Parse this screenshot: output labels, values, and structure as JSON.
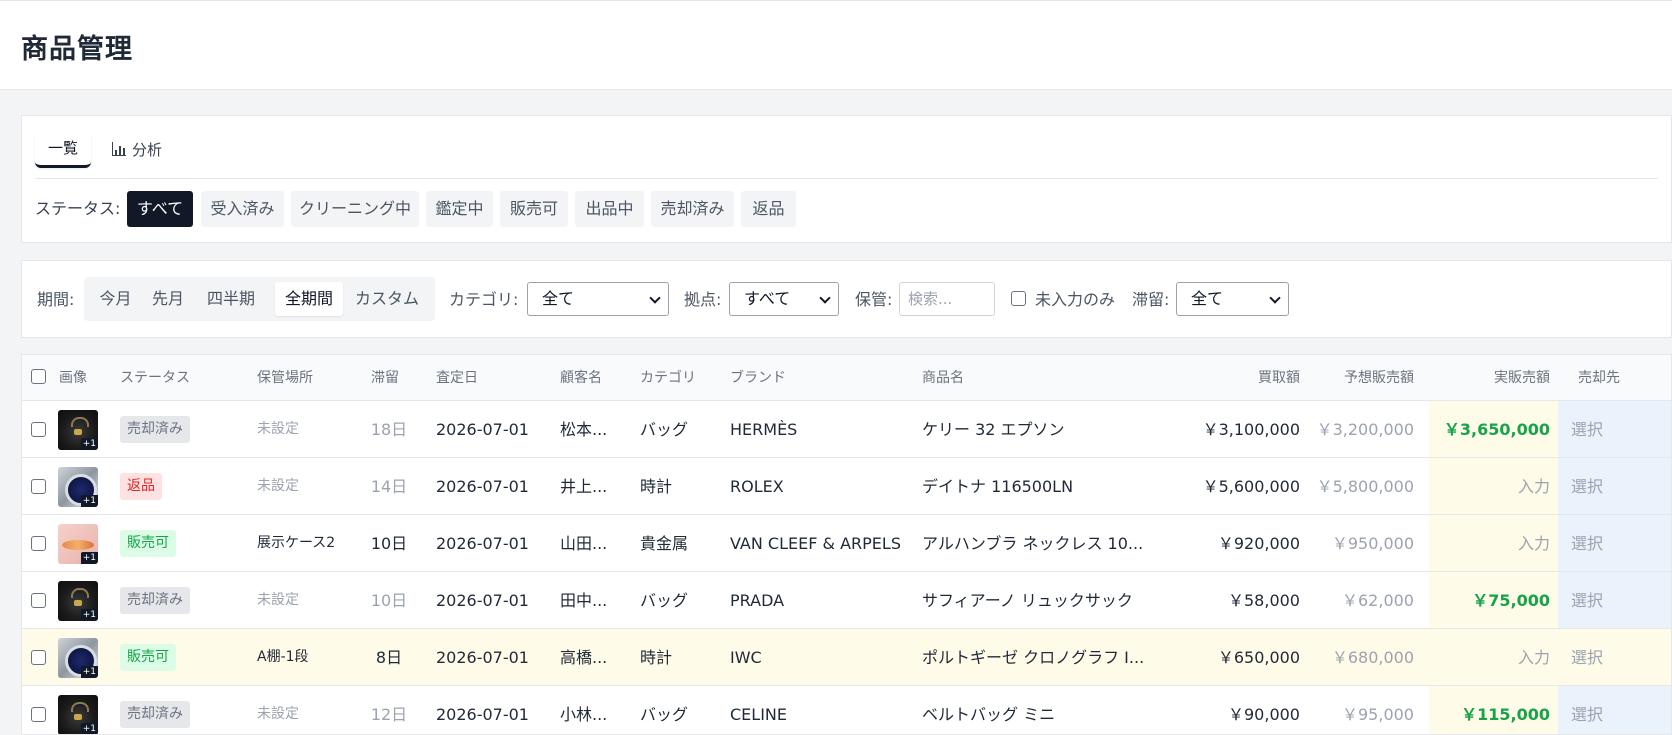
{
  "page": {
    "title": "商品管理"
  },
  "tabs": {
    "list": "一覧",
    "analysis": "分析"
  },
  "status_filter": {
    "label": "ステータス:",
    "options": [
      "すべて",
      "受入済み",
      "クリーニング中",
      "鑑定中",
      "販売可",
      "出品中",
      "売却済み",
      "返品"
    ],
    "selected": "すべて"
  },
  "filters": {
    "period_label": "期間:",
    "periods": [
      "今月",
      "先月",
      "四半期",
      "全期間",
      "カスタム"
    ],
    "period_selected": "全期間",
    "category_label": "カテゴリ:",
    "category_value": "全て",
    "location_label": "拠点:",
    "location_value": "すべて",
    "storage_label": "保管:",
    "storage_placeholder": "検索...",
    "unentered_label": "未入力のみ",
    "stagnation_label": "滞留:",
    "stagnation_value": "全て"
  },
  "table": {
    "headers": {
      "image": "画像",
      "status": "ステータス",
      "location": "保管場所",
      "stagnation": "滞留",
      "appraisal_date": "査定日",
      "customer": "顧客名",
      "category": "カテゴリ",
      "brand": "ブランド",
      "product": "商品名",
      "purchase": "買取額",
      "expected": "予想販売額",
      "actual": "実販売額",
      "buyer": "売却先"
    },
    "rows": [
      {
        "thumb": "bag-photo",
        "plus": "+1",
        "status": "売却済み",
        "location": "未設定",
        "stagnation": "18日",
        "date": "2026-07-01",
        "customer": "松本...",
        "category": "バッグ",
        "brand": "HERMÈS",
        "product": "ケリー 32 エプソン",
        "purchase": "￥3,100,000",
        "expected": "￥3,200,000",
        "actual": "￥3,650,000",
        "buyer": "選択"
      },
      {
        "thumb": "watch-photo",
        "plus": "+1",
        "status": "返品",
        "location": "未設定",
        "stagnation": "14日",
        "date": "2026-07-01",
        "customer": "井上...",
        "category": "時計",
        "brand": "ROLEX",
        "product": "デイトナ 116500LN",
        "purchase": "￥5,600,000",
        "expected": "￥5,800,000",
        "actual": "入力",
        "buyer": "選択"
      },
      {
        "thumb": "jewelry-photo",
        "plus": "+1",
        "status": "販売可",
        "location": "展示ケース2",
        "stagnation": "10日",
        "date": "2026-07-01",
        "customer": "山田...",
        "category": "貴金属",
        "brand": "VAN CLEEF & ARPELS",
        "product": "アルハンブラ ネックレス 10...",
        "purchase": "￥920,000",
        "expected": "￥950,000",
        "actual": "入力",
        "buyer": "選択"
      },
      {
        "thumb": "bag-photo",
        "plus": "+1",
        "status": "売却済み",
        "location": "未設定",
        "stagnation": "10日",
        "date": "2026-07-01",
        "customer": "田中...",
        "category": "バッグ",
        "brand": "PRADA",
        "product": "サフィアーノ リュックサック",
        "purchase": "￥58,000",
        "expected": "￥62,000",
        "actual": "￥75,000",
        "buyer": "選択"
      },
      {
        "thumb": "watch-photo",
        "plus": "+1",
        "status": "販売可",
        "location": "A棚-1段",
        "stagnation": "8日",
        "date": "2026-07-01",
        "customer": "高橋...",
        "category": "時計",
        "brand": "IWC",
        "product": "ポルトギーゼ クロノグラフ I...",
        "purchase": "￥650,000",
        "expected": "￥680,000",
        "actual": "入力",
        "buyer": "選択"
      },
      {
        "thumb": "bag-photo",
        "plus": "+1",
        "status": "売却済み",
        "location": "未設定",
        "stagnation": "12日",
        "date": "2026-07-01",
        "customer": "小林...",
        "category": "バッグ",
        "brand": "CELINE",
        "product": "ベルトバッグ ミニ",
        "purchase": "￥90,000",
        "expected": "￥95,000",
        "actual": "￥115,000",
        "buyer": "選択"
      }
    ]
  },
  "colors": {
    "active_dark": "#111827",
    "sold_green": "#16a34a",
    "returned_red": "#dc2626",
    "actual_col_bg": "#fefce8",
    "buyer_col_bg": "#eaf2fb"
  }
}
